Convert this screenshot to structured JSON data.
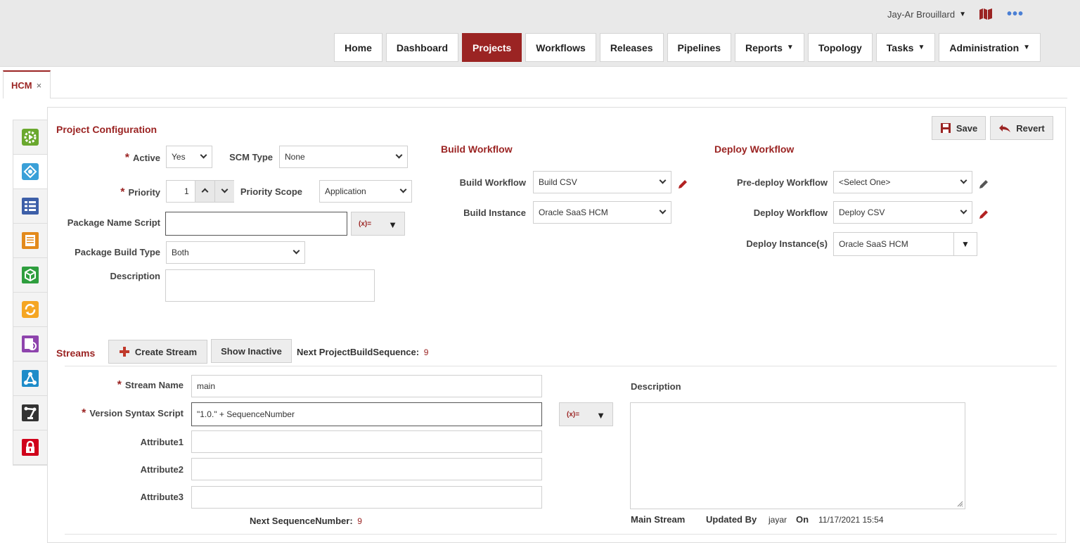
{
  "header": {
    "user_name": "Jay-Ar Brouillard",
    "more_label": "•••"
  },
  "nav": {
    "items": [
      {
        "label": "Home",
        "active": false
      },
      {
        "label": "Dashboard",
        "active": false
      },
      {
        "label": "Projects",
        "active": true
      },
      {
        "label": "Workflows",
        "active": false
      },
      {
        "label": "Releases",
        "active": false
      },
      {
        "label": "Pipelines",
        "active": false
      },
      {
        "label": "Reports",
        "dropdown": true
      },
      {
        "label": "Topology",
        "active": false
      },
      {
        "label": "Tasks",
        "dropdown": true
      },
      {
        "label": "Administration",
        "dropdown": true
      }
    ],
    "dropdown_arrow": "▼"
  },
  "tab": {
    "label": "HCM",
    "close": "×"
  },
  "sidebar": {
    "icons": [
      "gear-play-icon",
      "workflow-cycle-icon",
      "list-icon",
      "document-icon",
      "package-icon",
      "refresh-icon",
      "settings-report-icon",
      "network-icon",
      "robot-arm-icon",
      "lock-icon"
    ]
  },
  "toolbar": {
    "save_label": "Save",
    "revert_label": "Revert"
  },
  "project_config": {
    "title": "Project Configuration",
    "active_label": "Active",
    "active_value": "Yes",
    "scm_type_label": "SCM Type",
    "scm_type_value": "None",
    "priority_label": "Priority",
    "priority_value": "1",
    "priority_scope_label": "Priority Scope",
    "priority_scope_value": "Application",
    "package_name_script_label": "Package Name Script",
    "package_name_script_value": "",
    "package_build_type_label": "Package Build Type",
    "package_build_type_value": "Both",
    "description_label": "Description",
    "description_value": "",
    "expr_label": "(x)="
  },
  "build_workflow": {
    "title": "Build Workflow",
    "workflow_label": "Build Workflow",
    "workflow_value": "Build CSV",
    "instance_label": "Build Instance",
    "instance_value": "Oracle SaaS HCM"
  },
  "deploy_workflow": {
    "title": "Deploy Workflow",
    "predeploy_label": "Pre-deploy Workflow",
    "predeploy_value": "<Select One>",
    "deploy_label": "Deploy Workflow",
    "deploy_value": "Deploy CSV",
    "instances_label": "Deploy Instance(s)",
    "instances_value": "Oracle SaaS HCM"
  },
  "streams": {
    "title": "Streams",
    "create_label": "Create Stream",
    "show_inactive_label": "Show Inactive",
    "next_build_seq_label": "Next ProjectBuildSequence:",
    "next_build_seq_value": "9",
    "stream_name_label": "Stream Name",
    "stream_name_value": "main",
    "version_syntax_label": "Version Syntax Script",
    "version_syntax_value": "\"1.0.\" + SequenceNumber",
    "attribute1_label": "Attribute1",
    "attribute2_label": "Attribute2",
    "attribute3_label": "Attribute3",
    "next_seq_label": "Next SequenceNumber:",
    "next_seq_value": "9",
    "description_label": "Description",
    "main_stream_label": "Main Stream",
    "updated_by_label": "Updated By",
    "updated_by_value": "jayar",
    "on_label": "On",
    "on_value": "11/17/2021 15:54",
    "expr_label": "(x)="
  },
  "colors": {
    "accent": "#9b2423",
    "header_bg": "#e9e9e9"
  }
}
